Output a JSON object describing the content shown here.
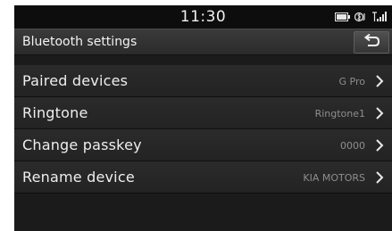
{
  "status": {
    "time": "11:30"
  },
  "header": {
    "title": "Bluetooth settings"
  },
  "items": [
    {
      "label": "Paired devices",
      "value": "G Pro"
    },
    {
      "label": "Ringtone",
      "value": "Ringtone1"
    },
    {
      "label": "Change passkey",
      "value": "0000"
    },
    {
      "label": "Rename device",
      "value": "KIA MOTORS"
    }
  ],
  "icons": {
    "battery": "battery-icon",
    "bluetooth_audio": "bluetooth-audio-icon",
    "signal": "signal-icon",
    "back": "back-arrow-icon",
    "chevron": "chevron-right-icon"
  }
}
